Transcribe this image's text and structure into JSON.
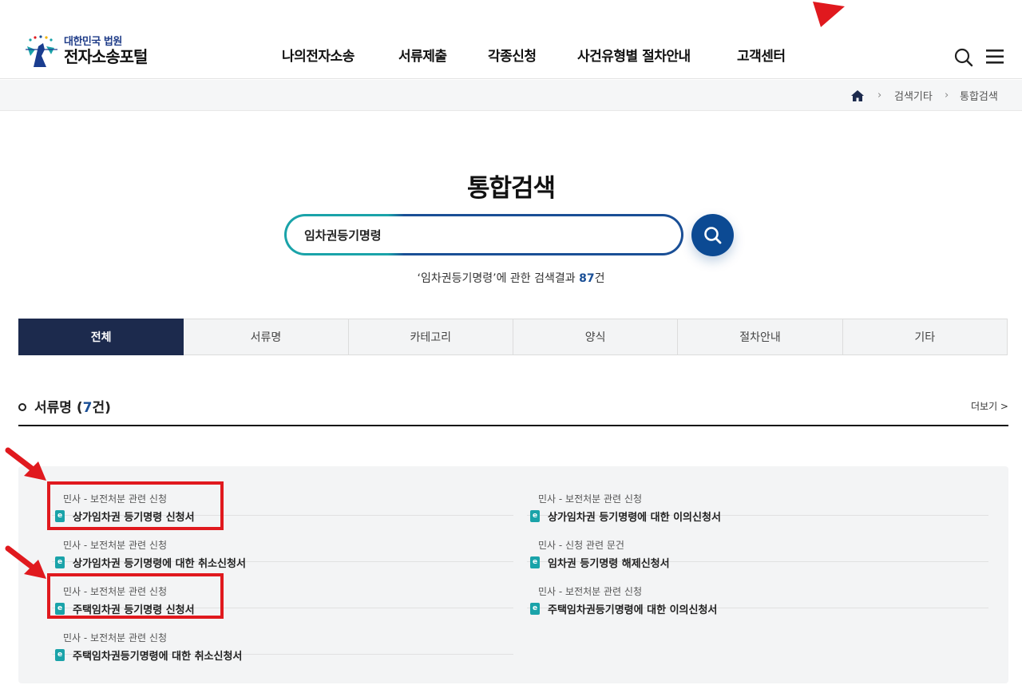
{
  "header": {
    "logo_sub": "대한민국 법원",
    "logo_main": "전자소송포털",
    "nav": [
      "나의전자소송",
      "서류제출",
      "각종신청",
      "사건유형별 절차안내",
      "고객센터"
    ]
  },
  "breadcrumb": {
    "items": [
      "검색기타",
      "통합검색"
    ]
  },
  "page": {
    "title": "통합검색"
  },
  "search": {
    "value": "임차권등기명령",
    "summary_prefix": "‘임차권등기명령’에 관한 검색결과 ",
    "count": "87",
    "summary_suffix": "건"
  },
  "tabs": [
    "전체",
    "서류명",
    "카테고리",
    "양식",
    "절차안내",
    "기타"
  ],
  "section": {
    "title": "서류명 (",
    "count": "7",
    "title_suffix": "건)",
    "more": "더보기 >"
  },
  "results": [
    {
      "category": "민사 - 보전처분 관련 신청",
      "title": "상가임차권 등기명령 신청서"
    },
    {
      "category": "민사 - 보전처분 관련 신청",
      "title": "상가임차권 등기명령에 대한 이의신청서"
    },
    {
      "category": "민사 - 보전처분 관련 신청",
      "title": "상가임차권 등기명령에 대한 취소신청서"
    },
    {
      "category": "민사 - 신청 관련 문건",
      "title": "임차권 등기명령 해제신청서"
    },
    {
      "category": "민사 - 보전처분 관련 신청",
      "title": "주택임차권 등기명령 신청서"
    },
    {
      "category": "민사 - 보전처분 관련 신청",
      "title": "주택임차권등기명령에 대한 이의신청서"
    },
    {
      "category": "민사 - 보전처분 관련 신청",
      "title": "주택임차권등기명령에 대한 취소신청서"
    }
  ],
  "colors": {
    "accent_navy": "#1c2a4d",
    "accent_blue": "#1a4f96",
    "accent_teal": "#1aa3a9",
    "annotation_red": "#e0191e"
  }
}
